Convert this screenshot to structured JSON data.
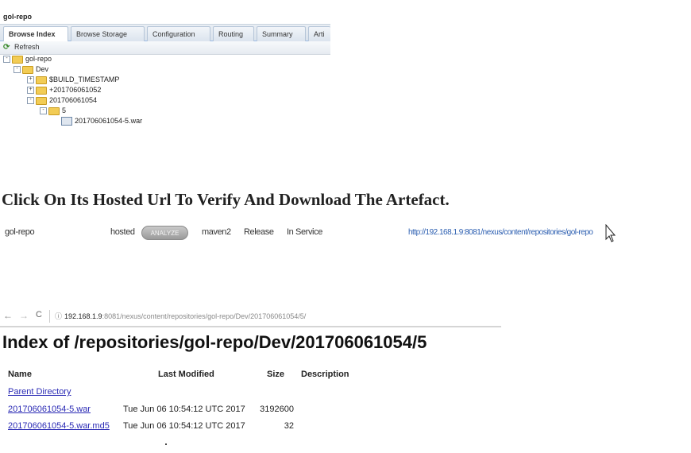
{
  "nexus": {
    "title": "gol-repo",
    "tabs": [
      {
        "label": "Browse Index",
        "active": true
      },
      {
        "label": "Browse Storage",
        "active": false
      },
      {
        "label": "Configuration",
        "active": false
      },
      {
        "label": "Routing",
        "active": false
      },
      {
        "label": "Summary",
        "active": false
      },
      {
        "label": "Arti",
        "active": false
      }
    ],
    "refresh_label": "Refresh",
    "tree": [
      {
        "label": "gol-repo",
        "type": "folder",
        "expander": "-"
      },
      {
        "label": "Dev",
        "type": "folder",
        "expander": "-"
      },
      {
        "label": "$BUILD_TIMESTAMP",
        "type": "folder",
        "expander": "+"
      },
      {
        "label": "+201706061052",
        "type": "folder",
        "expander": "+"
      },
      {
        "label": "201706061054",
        "type": "folder",
        "expander": "-"
      },
      {
        "label": "5",
        "type": "folder",
        "expander": "-"
      },
      {
        "label": "201706061054-5.war",
        "type": "file",
        "expander": ""
      }
    ]
  },
  "heading": "Click On Its Hosted Url To Verify And Download The Artefact.",
  "repo_row": {
    "name": "gol-repo",
    "type": "hosted",
    "analyze_label": "ANALYZE",
    "format": "maven2",
    "policy": "Release",
    "status": "In Service",
    "url": "http://192.168.1.9:8081/nexus/content/repositories/gol-repo"
  },
  "browser": {
    "back_icon": "←",
    "forward_icon": "→",
    "reload_icon": "C",
    "info_icon": "ⓘ",
    "address_host": "192.168.1.9",
    "address_path": ":8081/nexus/content/repositories/gol-repo/Dev/201706061054/5/"
  },
  "index": {
    "title": "Index of /repositories/gol-repo/Dev/201706061054/5",
    "columns": [
      "Name",
      "Last Modified",
      "Size",
      "Description"
    ],
    "parent_label": "Parent Directory",
    "rows": [
      {
        "name": "201706061054-5.war",
        "modified": "Tue Jun 06 10:54:12 UTC 2017",
        "size": "3192600",
        "description": ""
      },
      {
        "name": "201706061054-5.war.md5",
        "modified": "Tue Jun 06 10:54:12 UTC 2017",
        "size": "32",
        "description": ""
      }
    ]
  }
}
